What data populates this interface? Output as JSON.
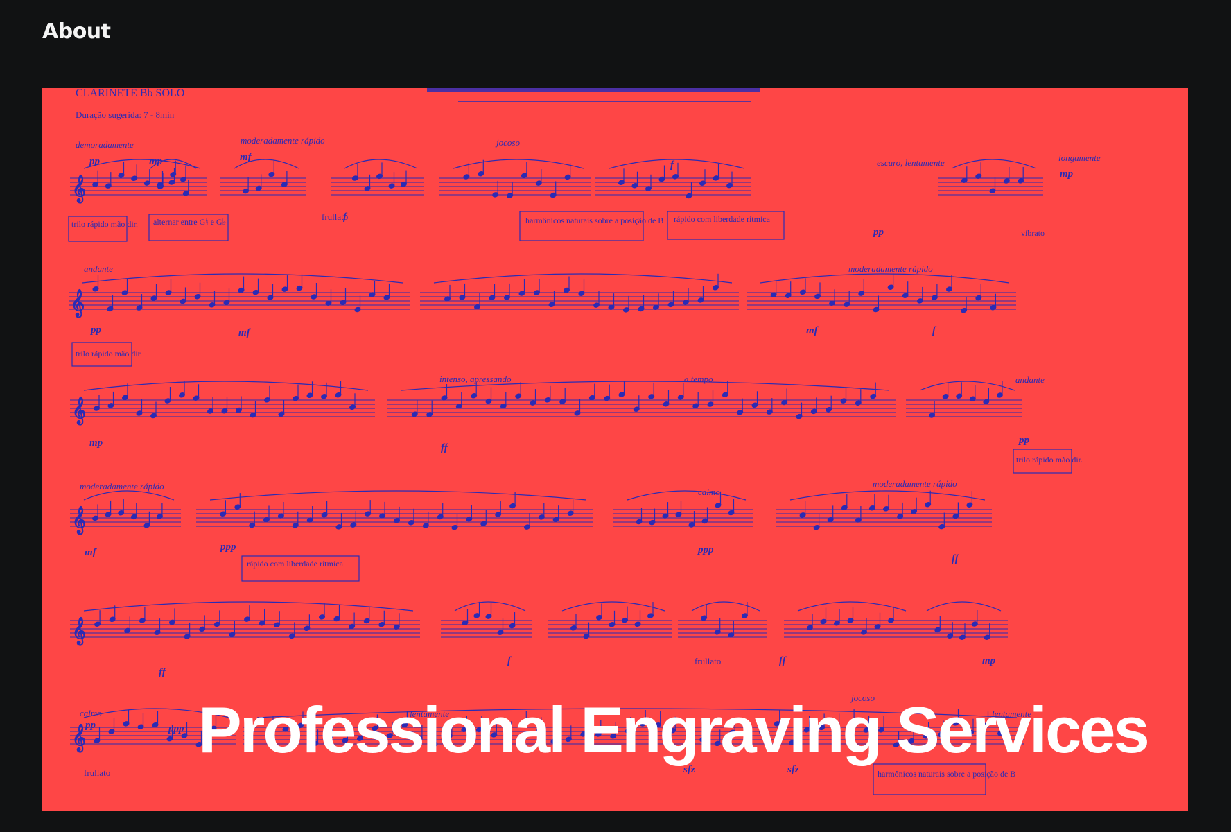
{
  "nav": {
    "about_label": "About"
  },
  "hero": {
    "headline": "Professional Engraving Services",
    "background_color": "#fe4646",
    "ink_color": "#2b2bb4"
  },
  "score": {
    "instrument": "CLARINETE Bb SOLO",
    "duration": "Duração sugerida: 7 - 8min",
    "tempo_marks": [
      "demoradamente",
      "moderadamente rápido",
      "jocoso",
      "escuro, lentamente",
      "longamente",
      "andante",
      "moderadamente rápido",
      "intenso, apressando",
      "a tempo",
      "andante",
      "moderadamente rápido",
      "calmo",
      "moderadamente rápido",
      "calmo",
      "lentamente",
      "jocoso",
      "lentamente"
    ],
    "annotations": [
      "trilo rápido mão dir.",
      "alternar entre G♮ e G♭",
      "frullato",
      "harmônicos naturais sobre a posição de B",
      "rápido com liberdade rítmica",
      "vibrato",
      "trilo rápido mão dir.",
      "trilo rápido mão dir.",
      "rápido com liberdade rítmica",
      "frullato",
      "frullato",
      "harmônicos naturais sobre a posição de B"
    ],
    "dynamics": [
      "pp",
      "mp",
      "mf",
      "f",
      "ff",
      "ppp",
      "sfz",
      "p"
    ]
  }
}
